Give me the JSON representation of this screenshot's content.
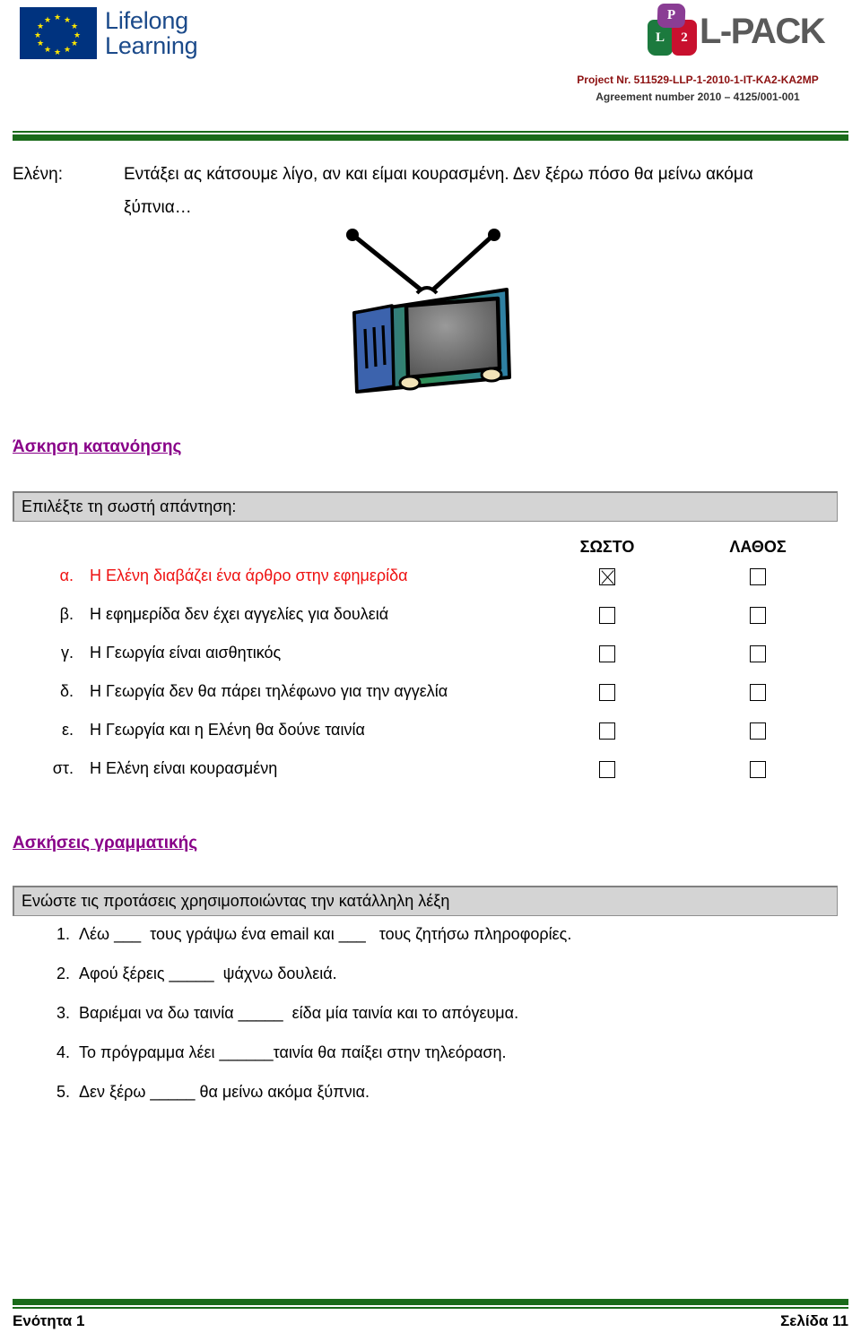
{
  "header": {
    "eu_logo": {
      "line1": "Lifelong",
      "line2": "Learning",
      "flag_color": "#00337f",
      "star_color": "#ffe800",
      "text_color": "#1b4a8a"
    },
    "lpack_logo": {
      "wordmark": "L-PACK",
      "cube_top_letter": "P",
      "cube_left_letter": "L",
      "cube_right_letter": "2",
      "cube_top_color": "#8a3d94",
      "cube_left_color": "#1c7a3e",
      "cube_right_color": "#c8102e",
      "wordmark_color": "#5a5a5a"
    },
    "project_line1": "Project Nr. 511529-LLP-1-2010-1-IT-KA2-KA2MP",
    "project_line2": "Agreement number 2010 – 4125/001-001",
    "project_line1_color": "#8c1010",
    "rule_color": "#1a6b1a"
  },
  "dialogue": {
    "speaker": "Ελένη:",
    "line1": "Εντάξει ας κάτσουμε λίγο, αν και είμαι κουρασμένη. Δεν ξέρω πόσο θα μείνω ακόμα",
    "line2": "ξύπνια…"
  },
  "illustration": {
    "name": "television-clipart",
    "body_color_left": "#3c6fb5",
    "body_color_right": "#2f9e3f",
    "screen_color": "#6e6e6e"
  },
  "comprehension": {
    "heading": "Άσκηση κατανόησης",
    "heading_color": "#880088",
    "instruction": "Επιλέξτε τη σωστή απάντηση:",
    "col_true": "ΣΩΣΤΟ",
    "col_false": "ΛΑΘΟΣ",
    "highlight_color": "#ee1111",
    "items": [
      {
        "marker": "α.",
        "text": "Η Ελένη διαβάζει ένα άρθρο στην εφημερίδα",
        "true_checked": true,
        "false_checked": false,
        "highlight": true
      },
      {
        "marker": "β.",
        "text": "Η εφημερίδα δεν έχει αγγελίες για δουλειά",
        "true_checked": false,
        "false_checked": false,
        "highlight": false
      },
      {
        "marker": "γ.",
        "text": "Η Γεωργία είναι αισθητικός",
        "true_checked": false,
        "false_checked": false,
        "highlight": false
      },
      {
        "marker": "δ.",
        "text": "Η Γεωργία  δεν θα πάρει τηλέφωνο για την αγγελία",
        "true_checked": false,
        "false_checked": false,
        "highlight": false
      },
      {
        "marker": "ε.",
        "text": "Η Γεωργία  και η Ελένη θα δούνε ταινία",
        "true_checked": false,
        "false_checked": false,
        "highlight": false
      },
      {
        "marker": "στ.",
        "text": "Η Ελένη είναι κουρασμένη",
        "true_checked": false,
        "false_checked": false,
        "highlight": false
      }
    ]
  },
  "grammar": {
    "heading": "Ασκήσεις γραμματικής",
    "heading_color": "#880088",
    "instruction": "Ενώστε τις προτάσεις χρησιμοποιώντας την κατάλληλη λέξη",
    "items": [
      {
        "num": "1.",
        "text": "Λέω ___  τους γράψω ένα email και ___   τους ζητήσω πληροφορίες."
      },
      {
        "num": "2.",
        "text": "Αφού ξέρεις _____  ψάχνω δουλειά."
      },
      {
        "num": "3.",
        "text": "Βαριέμαι να δω ταινία _____  είδα μία ταινία και το απόγευμα."
      },
      {
        "num": "4.",
        "text": "Το πρόγραμμα λέει ______ταινία θα παίξει στην τηλεόραση."
      },
      {
        "num": "5.",
        "text": "Δεν ξέρω _____ θα μείνω ακόμα ξύπνια."
      }
    ]
  },
  "footer": {
    "unit": "Ενότητα 1",
    "page": "Σελίδα 11",
    "rule_color": "#1a6b1a"
  }
}
